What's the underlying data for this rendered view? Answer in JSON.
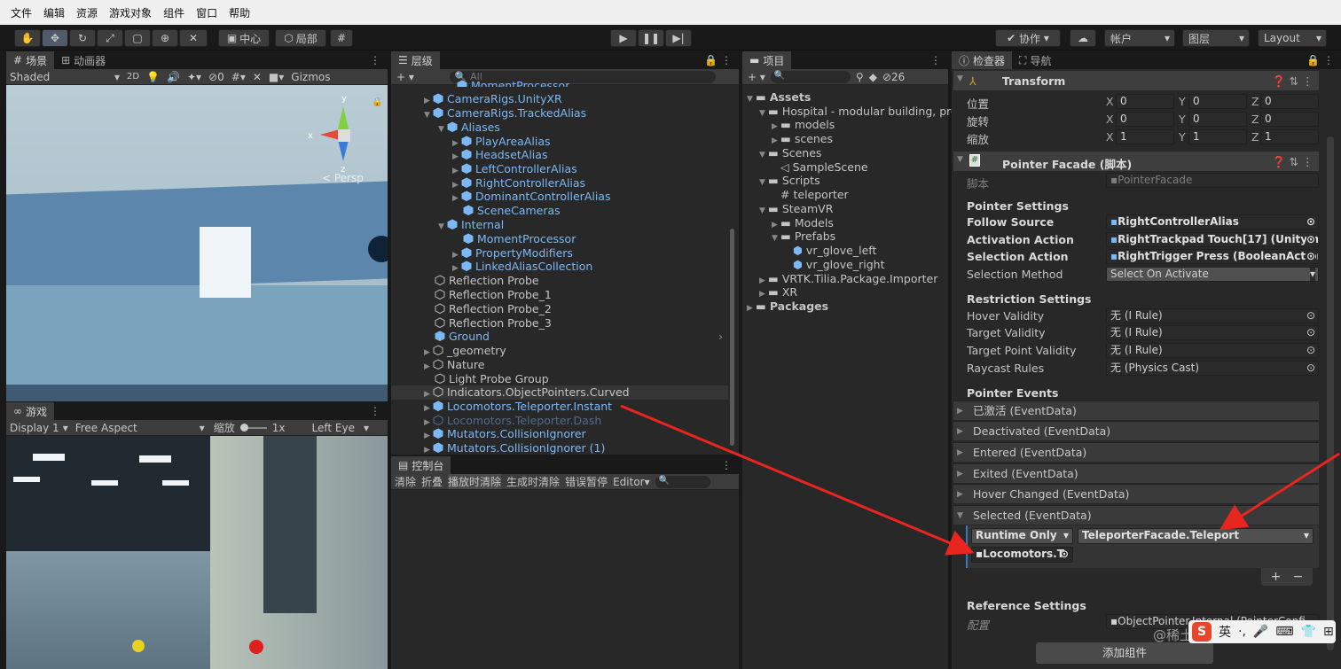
{
  "menu": [
    "文件",
    "编辑",
    "资源",
    "游戏对象",
    "组件",
    "窗口",
    "帮助"
  ],
  "toolbar": {
    "pivot": "中心",
    "local": "局部",
    "collab": "协作",
    "account": "帐户",
    "layers": "图层",
    "layout": "Layout"
  },
  "scene": {
    "tab_scene": "场景",
    "tab_animator": "动画器",
    "shading": "Shaded",
    "mode2d": "2D",
    "hidden_count": "0",
    "gizmos": "Gizmos",
    "persp": "< Persp",
    "axis_x": "x",
    "axis_y": "y",
    "axis_z": "z"
  },
  "game": {
    "tab": "游戏",
    "display": "Display 1",
    "aspect": "Free Aspect",
    "scale_label": "缩放",
    "scale_value": "1x",
    "eye": "Left Eye"
  },
  "hierarchy": {
    "tab": "层级",
    "search_placeholder": "All",
    "items": [
      "MomentProcessor",
      "CameraRigs.UnityXR",
      "CameraRigs.TrackedAlias",
      "Aliases",
      "PlayAreaAlias",
      "HeadsetAlias",
      "LeftControllerAlias",
      "RightControllerAlias",
      "DominantControllerAlias",
      "SceneCameras",
      "Internal",
      "MomentProcessor",
      "PropertyModifiers",
      "LinkedAliasCollection",
      "Reflection Probe",
      "Reflection Probe_1",
      "Reflection Probe_2",
      "Reflection Probe_3",
      "Ground",
      "_geometry",
      "Nature",
      "Light Probe Group",
      "Indicators.ObjectPointers.Curved",
      "Locomotors.Teleporter.Instant",
      "Locomotors.Teleporter.Dash",
      "Mutators.CollisionIgnorer",
      "Mutators.CollisionIgnorer (1)"
    ]
  },
  "console": {
    "tab": "控制台",
    "clear": "清除",
    "collapse": "折叠",
    "clear_on_play": "播放时清除",
    "clear_on_build": "生成时清除",
    "error_pause": "错误暂停",
    "editor": "Editor"
  },
  "project": {
    "tab": "项目",
    "hidden_count": "26",
    "items": [
      "Assets",
      "Hospital - modular building, pro",
      "models",
      "scenes",
      "Scenes",
      "SampleScene",
      "Scripts",
      "teleporter",
      "SteamVR",
      "Models",
      "Prefabs",
      "vr_glove_left",
      "vr_glove_right",
      "VRTK.Tilia.Package.Importer",
      "XR",
      "Packages"
    ]
  },
  "inspector": {
    "tab_inspector": "检查器",
    "tab_nav": "导航",
    "transform": {
      "title": "Transform",
      "rows": [
        {
          "label": "位置",
          "x": "0",
          "y": "0",
          "z": "0"
        },
        {
          "label": "旋转",
          "x": "0",
          "y": "0",
          "z": "0"
        },
        {
          "label": "缩放",
          "x": "1",
          "y": "1",
          "z": "1"
        }
      ]
    },
    "component": {
      "title": "Pointer Facade   (脚本)",
      "script_label": "脚本",
      "script_value": "PointerFacade"
    },
    "pointer_settings": {
      "header": "Pointer Settings",
      "rows": [
        {
          "label": "Follow Source",
          "value": "RightControllerAlias"
        },
        {
          "label": "Activation Action",
          "value": "RightTrackpad Touch[17] (UnityIn"
        },
        {
          "label": "Selection Action",
          "value": "RightTrigger Press (BooleanAction"
        },
        {
          "label": "Selection Method",
          "value": "Select On Activate"
        }
      ]
    },
    "restriction": {
      "header": "Restriction Settings",
      "rows": [
        {
          "label": "Hover Validity",
          "value": "无 (I Rule)"
        },
        {
          "label": "Target Validity",
          "value": "无 (I Rule)"
        },
        {
          "label": "Target Point Validity",
          "value": "无 (I Rule)"
        },
        {
          "label": "Raycast Rules",
          "value": "无 (Physics Cast)"
        }
      ]
    },
    "events": {
      "header": "Pointer Events",
      "items": [
        "已激活 (EventData)",
        "Deactivated (EventData)",
        "Entered (EventData)",
        "Exited (EventData)",
        "Hover Changed (EventData)",
        "Selected (EventData)"
      ]
    },
    "selected_event": {
      "runtime": "Runtime Only",
      "function": "TeleporterFacade.Teleport",
      "object": "Locomotors.T"
    },
    "reference": {
      "header": "Reference Settings",
      "label": "配置",
      "value": "ObjectPointer.Internal (PointerConfi"
    },
    "add_component": "添加组件"
  },
  "watermark": "@稀土掘金技术社区",
  "ime": "英"
}
